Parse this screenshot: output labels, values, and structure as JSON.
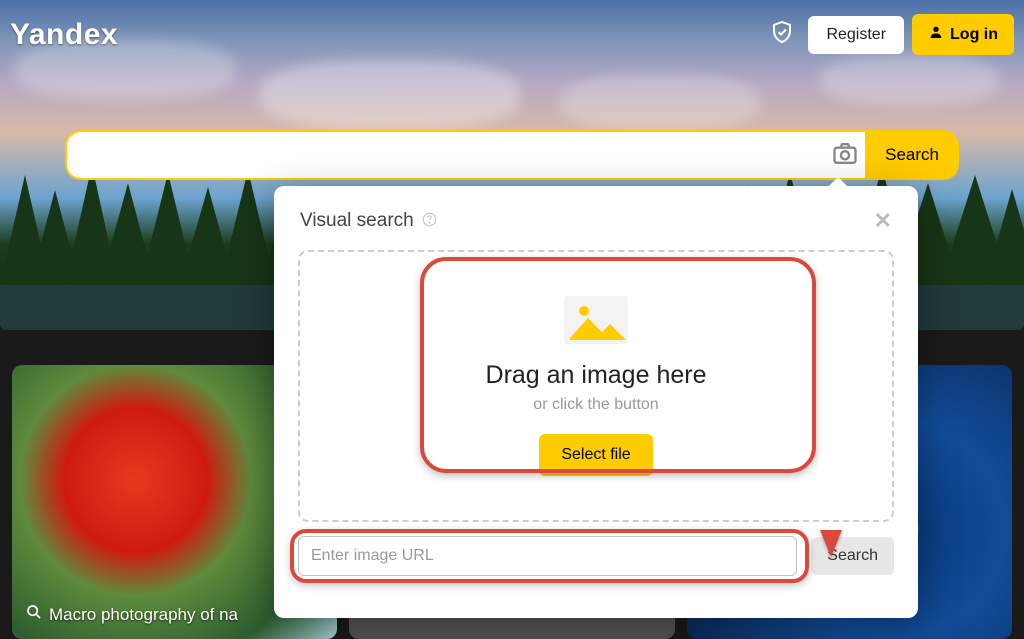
{
  "brand": "Yandex",
  "header": {
    "register_label": "Register",
    "login_label": "Log in"
  },
  "search": {
    "value": "",
    "button_label": "Search"
  },
  "visual_search": {
    "title": "Visual search",
    "drop_text": "Drag an image here",
    "drop_sub": "or click the button",
    "select_file_label": "Select file",
    "url_placeholder": "Enter image URL",
    "url_search_label": "Search"
  },
  "gallery": {
    "card1_caption": "Macro photography of na"
  },
  "colors": {
    "accent": "#ffcc00",
    "annotation": "#d94a3d"
  }
}
